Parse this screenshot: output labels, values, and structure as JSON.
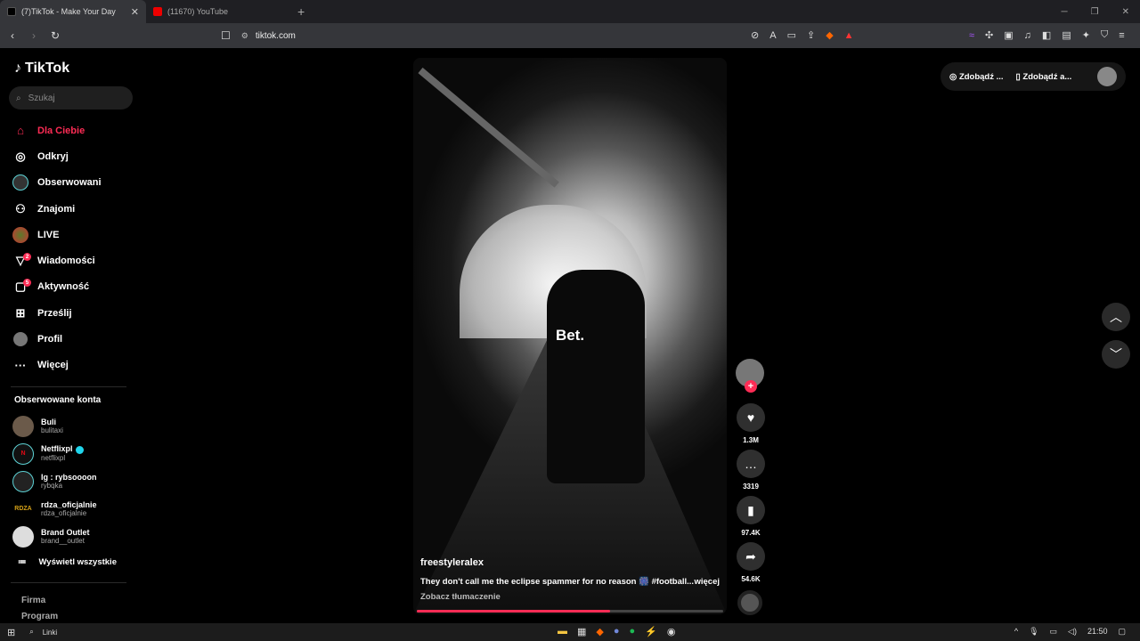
{
  "browser": {
    "tabs": [
      {
        "title": "(7)TikTok - Make Your Day",
        "active": true
      },
      {
        "title": "(11670) YouTube",
        "active": false
      }
    ],
    "url": "tiktok.com"
  },
  "sidebar": {
    "logo": "TikTok",
    "search_placeholder": "Szukaj",
    "nav": [
      {
        "label": "Dla Ciebie",
        "icon": "home-icon"
      },
      {
        "label": "Odkryj",
        "icon": "compass-icon"
      },
      {
        "label": "Obserwowani",
        "icon": "following-avatar-icon"
      },
      {
        "label": "Znajomi",
        "icon": "friends-icon"
      },
      {
        "label": "LIVE",
        "icon": "live-icon"
      },
      {
        "label": "Wiadomości",
        "icon": "messages-icon",
        "badge": "2"
      },
      {
        "label": "Aktywność",
        "icon": "activity-icon",
        "badge": "5"
      },
      {
        "label": "Prześlij",
        "icon": "upload-icon"
      },
      {
        "label": "Profil",
        "icon": "profile-avatar-icon"
      },
      {
        "label": "Więcej",
        "icon": "more-icon"
      }
    ],
    "following_title": "Obserwowane konta",
    "accounts": [
      {
        "name": "Buli",
        "handle": "bulitaxi",
        "verified": false
      },
      {
        "name": "Netflixpl",
        "handle": "netflixpl",
        "verified": true
      },
      {
        "name": "Ig : rybsoooon",
        "handle": "rybqka",
        "verified": false
      },
      {
        "name": "rdza_oficjalnie",
        "handle": "rdza_oficjalnie",
        "verified": false
      },
      {
        "name": "Brand Outlet",
        "handle": "brand__outlet",
        "verified": false
      }
    ],
    "see_all": "Wyświetl wszystkie",
    "footer": [
      "Firma",
      "Program"
    ]
  },
  "video": {
    "overlay_text": "Bet.",
    "author": "freestyleralex",
    "caption": "They don't call me the eclipse spammer for no reason 🎆 #football...",
    "more": "więcej",
    "translate": "Zobacz tłumaczenie",
    "progress": 0.63
  },
  "actions": {
    "likes": "1.3M",
    "comments": "3319",
    "saves": "97.4K",
    "shares": "54.6K"
  },
  "topright": {
    "btn1": "Zdobądź ...",
    "btn2": "Zdobądź a..."
  },
  "taskbar": {
    "search_label": "Linki",
    "time": "21:50"
  }
}
